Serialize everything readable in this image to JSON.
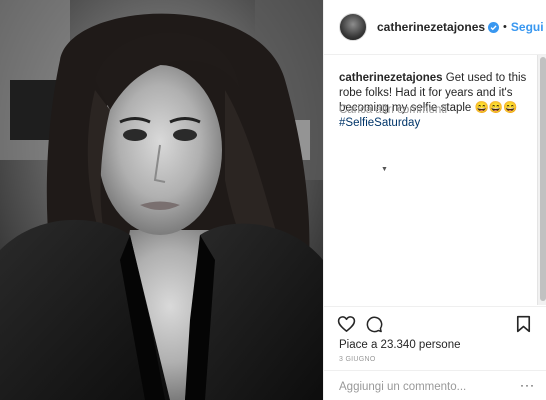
{
  "post": {
    "username": "catherinezetajones",
    "verified": true,
    "follow_separator": "•",
    "follow_label": "Segui",
    "caption_username": "catherinezetajones",
    "caption_text": "Get used to this robe folks! Had it for years and it's becoming my selfie staple 😄😄😄",
    "hashtag": "#SelfieSaturday",
    "load_more_comments": "Carica altri commenti",
    "likes_text": "Piace a 23.340 persone",
    "date": "3 GIUGNO",
    "comment_placeholder": "Aggiungi un commento...",
    "more_options": "···"
  },
  "icons": {
    "like": "heart-icon",
    "comment": "comment-icon",
    "save": "bookmark-icon",
    "verified": "verified-badge-icon",
    "scroll": "caret-down-icon"
  },
  "colors": {
    "follow_blue": "#3897f0",
    "hashtag": "#003569",
    "secondary_text": "#999999",
    "verified_blue": "#3897f0"
  }
}
